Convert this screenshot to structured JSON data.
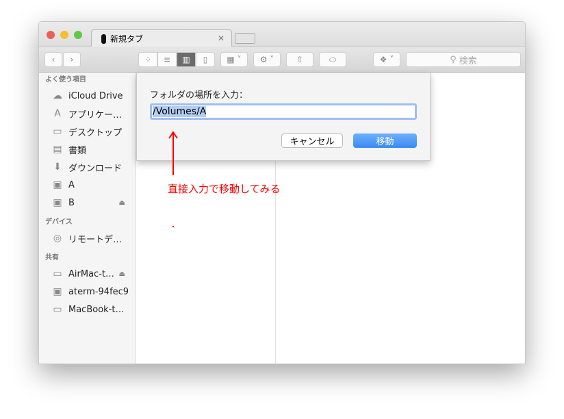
{
  "window": {
    "tab_title": "新規タブ",
    "search_placeholder": "検索"
  },
  "sidebar": {
    "sections": [
      {
        "header": "よく使う項目",
        "items": [
          {
            "label": "iCloud Drive",
            "icon": "cloud-icon"
          },
          {
            "label": "アプリケー…",
            "icon": "applications-icon"
          },
          {
            "label": "デスクトップ",
            "icon": "desktop-icon"
          },
          {
            "label": "書類",
            "icon": "documents-icon"
          },
          {
            "label": "ダウンロード",
            "icon": "download-icon"
          },
          {
            "label": "A",
            "icon": "disk-icon"
          },
          {
            "label": "B",
            "icon": "disk-icon"
          }
        ]
      },
      {
        "header": "デバイス",
        "items": [
          {
            "label": "リモートデ…",
            "icon": "disc-icon"
          }
        ]
      },
      {
        "header": "共有",
        "items": [
          {
            "label": "AirMac-t…",
            "icon": "display-icon"
          },
          {
            "label": "aterm-94fec9",
            "icon": "monitor-icon"
          },
          {
            "label": "MacBook-t…",
            "icon": "display-icon"
          }
        ]
      }
    ]
  },
  "dialog": {
    "label": "フォルダの場所を入力：",
    "value": "/Volumes/A",
    "cancel": "キャンセル",
    "go": "移動"
  },
  "annotation": {
    "text": "直接入力で移動してみる",
    "color": "#ff0000"
  }
}
